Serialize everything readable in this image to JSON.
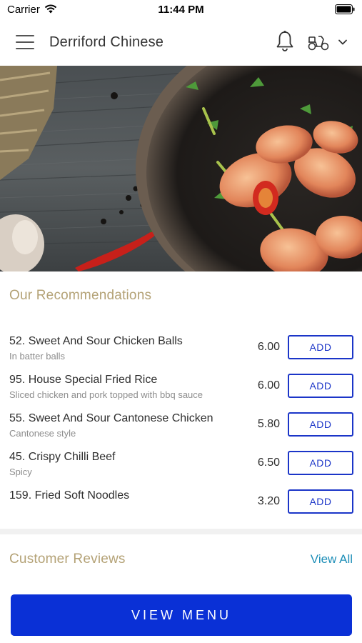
{
  "status_bar": {
    "carrier": "Carrier",
    "time": "11:44 PM"
  },
  "header": {
    "title": "Derriford Chinese",
    "icons": [
      "menu-icon",
      "bell-icon",
      "scooter-icon",
      "chevron-down-icon"
    ]
  },
  "recommendations": {
    "title": "Our Recommendations",
    "items": [
      {
        "name": "52. Sweet And Sour Chicken Balls",
        "description": "In batter balls",
        "price": "6.00",
        "add_label": "ADD"
      },
      {
        "name": "95. House Special Fried Rice",
        "description": "Sliced chicken and pork topped with bbq sauce",
        "price": "6.00",
        "add_label": "ADD"
      },
      {
        "name": "55. Sweet And Sour Cantonese Chicken",
        "description": "Cantonese style",
        "price": "5.80",
        "add_label": "ADD"
      },
      {
        "name": "45. Crispy Chilli Beef",
        "description": "Spicy",
        "price": "6.50",
        "add_label": "ADD"
      },
      {
        "name": "159. Fried Soft Noodles",
        "description": "",
        "price": "3.20",
        "add_label": "ADD"
      }
    ]
  },
  "reviews": {
    "title": "Customer Reviews",
    "view_all_label": "View All"
  },
  "bottom": {
    "view_menu_label": "VIEW MENU"
  },
  "colors": {
    "accent_gold": "#b4a276",
    "button_blue": "#0a30d6",
    "link_blue": "#1f8fb8"
  }
}
